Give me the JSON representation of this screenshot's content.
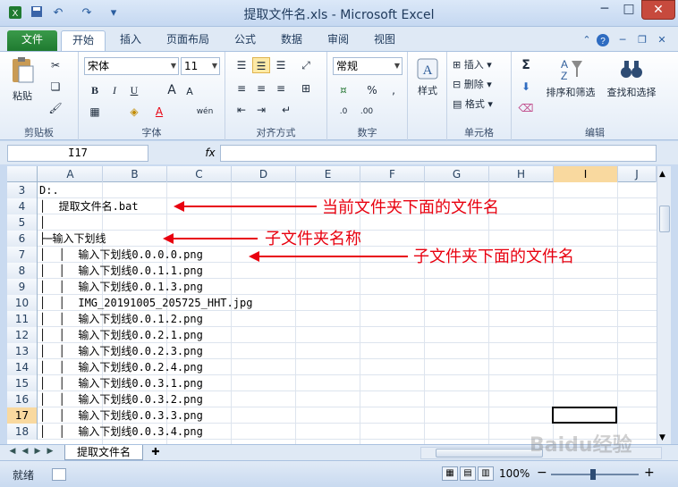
{
  "window": {
    "title": "提取文件名.xls - Microsoft Excel",
    "minimize": "─",
    "maximize": "□",
    "close": "✕"
  },
  "tabs": [
    {
      "label": "文件"
    },
    {
      "label": "开始"
    },
    {
      "label": "插入"
    },
    {
      "label": "页面布局"
    },
    {
      "label": "公式"
    },
    {
      "label": "数据"
    },
    {
      "label": "审阅"
    },
    {
      "label": "视图"
    }
  ],
  "ribbon": {
    "clipboard": {
      "label": "剪贴板",
      "paste": "粘贴"
    },
    "font": {
      "label": "字体",
      "name": "宋体",
      "size": "11",
      "bold": "B",
      "italic": "I",
      "underline": "U",
      "grow": "A",
      "shrink": "A",
      "phonetic": "wén"
    },
    "alignment": {
      "label": "对齐方式"
    },
    "number": {
      "label": "数字",
      "format": "常规",
      "percent": "%"
    },
    "styles": {
      "label": "样式"
    },
    "cells": {
      "label": "单元格",
      "insert": "插入",
      "delete": "删除",
      "format": "格式"
    },
    "editing": {
      "label": "编辑",
      "sort_filter": "排序和筛选",
      "find_select": "查找和选择"
    }
  },
  "formula_bar": {
    "name_box": "I17",
    "fx": "fx",
    "formula": ""
  },
  "columns": [
    "A",
    "B",
    "C",
    "D",
    "E",
    "F",
    "G",
    "H",
    "I",
    "J"
  ],
  "selected_column": "I",
  "selected_row": "17",
  "rows": [
    {
      "num": "3",
      "text": "D:."
    },
    {
      "num": "4",
      "text": "│  提取文件名.bat"
    },
    {
      "num": "5",
      "text": "│"
    },
    {
      "num": "6",
      "text": "├─输入下划线"
    },
    {
      "num": "7",
      "text": "│  │  输入下划线0.0.0.0.png"
    },
    {
      "num": "8",
      "text": "│  │  输入下划线0.0.1.1.png"
    },
    {
      "num": "9",
      "text": "│  │  输入下划线0.0.1.3.png"
    },
    {
      "num": "10",
      "text": "│  │  IMG_20191005_205725_HHT.jpg"
    },
    {
      "num": "11",
      "text": "│  │  输入下划线0.0.1.2.png"
    },
    {
      "num": "12",
      "text": "│  │  输入下划线0.0.2.1.png"
    },
    {
      "num": "13",
      "text": "│  │  输入下划线0.0.2.3.png"
    },
    {
      "num": "14",
      "text": "│  │  输入下划线0.0.2.4.png"
    },
    {
      "num": "15",
      "text": "│  │  输入下划线0.0.3.1.png"
    },
    {
      "num": "16",
      "text": "│  │  输入下划线0.0.3.2.png"
    },
    {
      "num": "17",
      "text": "│  │  输入下划线0.0.3.3.png"
    },
    {
      "num": "18",
      "text": "│  │  输入下划线0.0.3.4.png"
    }
  ],
  "annotations": {
    "current_folder": "当前文件夹下面的文件名",
    "subfolder_name": "子文件夹名称",
    "subfolder_files": "子文件夹下面的文件名"
  },
  "sheet": {
    "tab": "提取文件名"
  },
  "status": {
    "ready": "就绪",
    "zoom": "100%",
    "zoom_out": "−",
    "zoom_in": "+"
  },
  "watermark": "Baidu经验",
  "colors": {
    "accent_red": "#e8000f",
    "file_tab": "#1f7a30",
    "selection": "#f9d99f"
  }
}
